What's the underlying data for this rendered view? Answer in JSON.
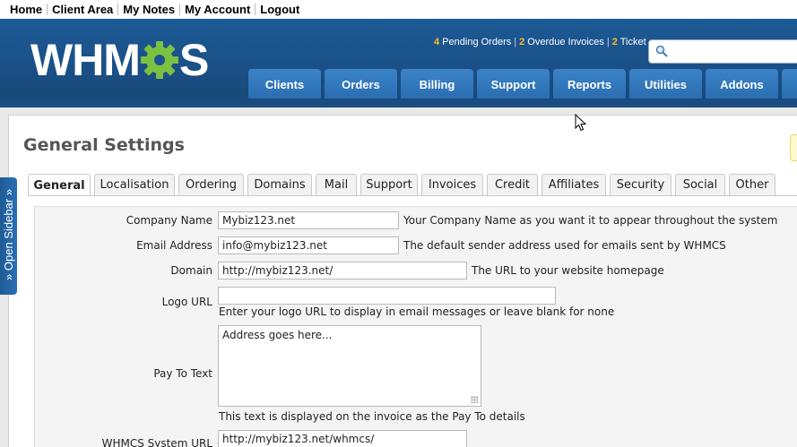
{
  "top_links": [
    "Home",
    "Client Area",
    "My Notes",
    "My Account",
    "Logout"
  ],
  "brand": {
    "left": "WHM",
    "right": "S"
  },
  "status": {
    "pending_count": "4",
    "pending_label": "Pending Orders",
    "overdue_count": "2",
    "overdue_label": "Overdue Invoices",
    "tickets_count": "2",
    "tickets_label": "Ticket"
  },
  "search": {
    "placeholder": "",
    "icon": "search-icon"
  },
  "nav_tabs": [
    "Clients",
    "Orders",
    "Billing",
    "Support",
    "Reports",
    "Utilities",
    "Addons"
  ],
  "page_title": "General Settings",
  "settings_tabs": [
    "General",
    "Localisation",
    "Ordering",
    "Domains",
    "Mail",
    "Support",
    "Invoices",
    "Credit",
    "Affiliates",
    "Security",
    "Social",
    "Other"
  ],
  "active_tab": "General",
  "sidebar_toggle": "» Open Sidebar »",
  "form": {
    "company_name": {
      "label": "Company Name",
      "value": "Mybiz123.net",
      "hint": "Your Company Name as you want it to appear throughout the system"
    },
    "email_address": {
      "label": "Email Address",
      "value": "info@mybiz123.net",
      "hint": "The default sender address used for emails sent by WHMCS"
    },
    "domain": {
      "label": "Domain",
      "value": "http://mybiz123.net/",
      "hint": "The URL to your website homepage"
    },
    "logo_url": {
      "label": "Logo URL",
      "value": "",
      "hint": "Enter your logo URL to display in email messages or leave blank for none"
    },
    "pay_to_text": {
      "label": "Pay To Text",
      "value": "Address goes here...",
      "hint": "This text is displayed on the invoice as the Pay To details"
    },
    "system_url": {
      "label": "WHMCS System URL",
      "value": "http://mybiz123.net/whmcs/"
    }
  },
  "colors": {
    "header_blue": "#1a4f85",
    "tab_blue": "#2a6db0",
    "status_number": "#f6c020",
    "gear_green": "#7bc142"
  }
}
